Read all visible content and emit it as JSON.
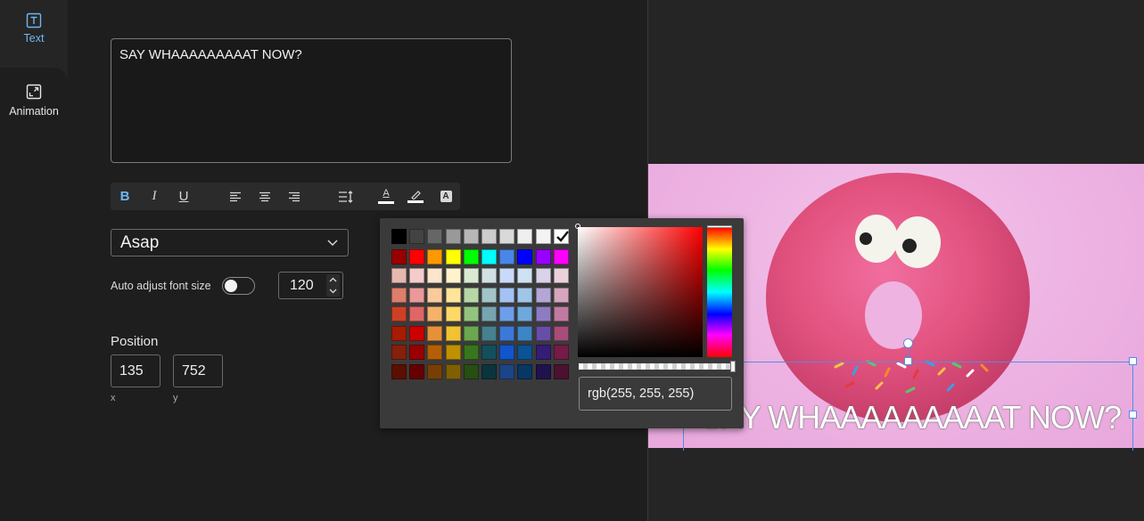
{
  "sidebar": {
    "items": [
      {
        "label": "Text",
        "icon": "text-box-icon",
        "active": true
      },
      {
        "label": "Animation",
        "icon": "expand-box-icon",
        "active": false
      }
    ]
  },
  "editor": {
    "text_value": "SAY WHAAAAAAAAAT NOW?",
    "toolbar": {
      "bold": "B",
      "italic": "I",
      "underline": "U",
      "text_color_glyph": "A",
      "background_glyph": "A"
    },
    "font": {
      "selected": "Asap"
    },
    "auto_adjust_label": "Auto adjust font size",
    "auto_adjust_on": false,
    "font_size": "120",
    "position": {
      "label": "Position",
      "x": "135",
      "y": "752",
      "x_caption": "x",
      "y_caption": "y"
    }
  },
  "color_picker": {
    "value": "rgb(255, 255, 255)",
    "selected_swatch": "#ffffff",
    "swatch_rows": [
      [
        "#000000",
        "#434343",
        "#666666",
        "#999999",
        "#b7b7b7",
        "#cccccc",
        "#d9d9d9",
        "#efefef",
        "#f3f3f3",
        "#ffffff"
      ],
      [
        "#980000",
        "#ff0000",
        "#ff9900",
        "#ffff00",
        "#00ff00",
        "#00ffff",
        "#4a86e8",
        "#0000ff",
        "#9900ff",
        "#ff00ff"
      ],
      [
        "#e6b8af",
        "#f4cccc",
        "#fce5cd",
        "#fff2cc",
        "#d9ead3",
        "#d0e0e3",
        "#c9daf8",
        "#cfe2f3",
        "#d9d2e9",
        "#ead1dc"
      ],
      [
        "#dd7e6b",
        "#ea9999",
        "#f9cb9c",
        "#ffe599",
        "#b6d7a8",
        "#a2c4c9",
        "#a4c2f4",
        "#9fc5e8",
        "#b4a7d6",
        "#d5a6bd"
      ],
      [
        "#cc4125",
        "#e06666",
        "#f6b26b",
        "#ffd966",
        "#93c47d",
        "#76a5af",
        "#6d9eeb",
        "#6fa8dc",
        "#8e7cc3",
        "#c27ba0"
      ],
      [
        "#a61c00",
        "#cc0000",
        "#e69138",
        "#f1c232",
        "#6aa84f",
        "#45818e",
        "#3c78d8",
        "#3d85c6",
        "#674ea7",
        "#a64d79"
      ],
      [
        "#85200c",
        "#990000",
        "#b45f06",
        "#bf9000",
        "#38761d",
        "#134f5c",
        "#1155cc",
        "#0b5394",
        "#351c75",
        "#741b47"
      ],
      [
        "#5b0f00",
        "#660000",
        "#783f04",
        "#7f6000",
        "#274e13",
        "#0c343d",
        "#1c4587",
        "#073763",
        "#20124d",
        "#4c1130"
      ]
    ]
  },
  "canvas": {
    "overlay_text": "SAY WHAAAAAAAAAT NOW?"
  }
}
